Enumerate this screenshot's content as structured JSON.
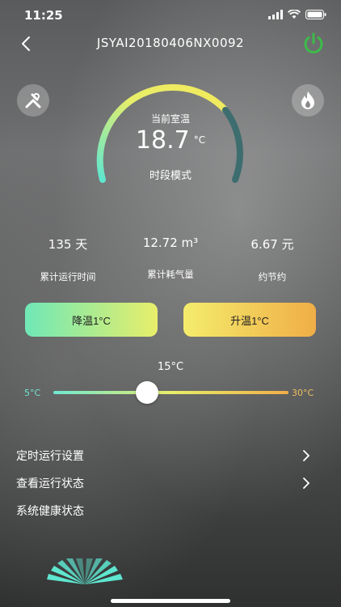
{
  "status_bar": {
    "time": "11:25"
  },
  "header": {
    "title": "JSYAI20180406NX0092"
  },
  "gauge": {
    "label": "当前室温",
    "temperature": "18.7",
    "unit": "°C",
    "mode": "时段模式",
    "colors": {
      "start": "#5ee6d0",
      "mid": "#e8ee6a",
      "end": "#3d6d6f"
    }
  },
  "stats": [
    {
      "value": "135 天",
      "label": "累计运行时间"
    },
    {
      "value": "12.72 m³",
      "label": "累计耗气量"
    },
    {
      "value": "6.67 元",
      "label": "约节约"
    }
  ],
  "buttons": {
    "decrease": "降温1°C",
    "increase": "升温1°C"
  },
  "slider": {
    "value_label": "15°C",
    "min_label": "5°C",
    "max_label": "30°C",
    "min": 5,
    "max": 30,
    "value": 15
  },
  "menu": [
    {
      "label": "定时运行设置"
    },
    {
      "label": "查看运行状态"
    },
    {
      "label": "系统健康状态"
    }
  ],
  "icons": {
    "back": "chevron-left-icon",
    "power": "power-icon",
    "tools": "tools-icon",
    "fire": "fire-icon",
    "chevron": "chevron-right-icon",
    "fan": "fan-icon"
  },
  "accent_colors": {
    "power": "#3dbb4a",
    "fan": "#5ee6d0"
  }
}
